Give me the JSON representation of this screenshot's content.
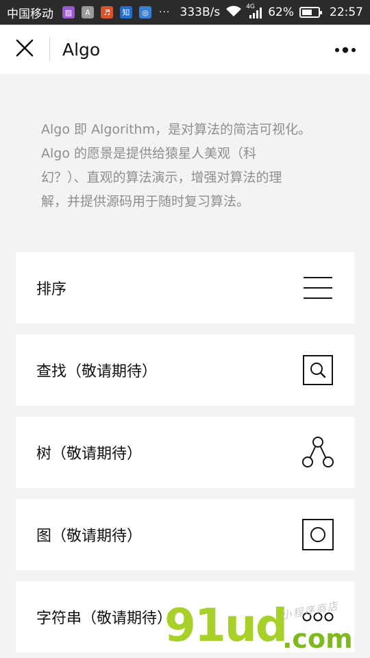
{
  "statusbar": {
    "carrier": "中国移动",
    "apps": [
      {
        "icon": "gallery-app-icon",
        "glyph": "▨",
        "color": "#9b59d0"
      },
      {
        "icon": "a-app-icon",
        "glyph": "A",
        "color": "#9a9a9a"
      },
      {
        "icon": "music-app-icon",
        "glyph": "♬",
        "color": "#d9532b"
      },
      {
        "icon": "zhihu-app-icon",
        "glyph": "知",
        "color": "#1f6fd1"
      },
      {
        "icon": "wifi-app-icon",
        "glyph": "◎",
        "color": "#3a7fd6"
      }
    ],
    "more": "···",
    "speed": "333B/s",
    "network": "4G",
    "battery_percent": "62%",
    "battery_level": 0.62,
    "time": "22:57"
  },
  "navbar": {
    "title": "Algo",
    "close_icon": "close-icon",
    "more_icon": "more-icon"
  },
  "intro": {
    "lines": [
      "Algo 即 Algorithm，是对算法的简洁可视化。",
      "Algo 的愿景是提供给猿星人美观（科",
      "幻？）、直观的算法演示，增强对算法的理",
      "解，并提供源码用于随时复习算法。"
    ]
  },
  "cards": [
    {
      "label": "排序",
      "icon": "menu-lines-icon"
    },
    {
      "label": "查找（敬请期待）",
      "icon": "search-icon"
    },
    {
      "label": "树（敬请期待）",
      "icon": "tree-icon"
    },
    {
      "label": "图（敬请期待）",
      "icon": "graph-circle-icon"
    },
    {
      "label": "字符串（敬请期待）",
      "icon": "dots-icon"
    }
  ],
  "watermark": {
    "brand": "91ud",
    "domain": ".com",
    "tagline": "小程序商店"
  },
  "colors": {
    "background": "#f3f3f3",
    "card": "#ffffff",
    "intro_text": "#8e8e8e",
    "statusbar": "#2b2b2b"
  }
}
